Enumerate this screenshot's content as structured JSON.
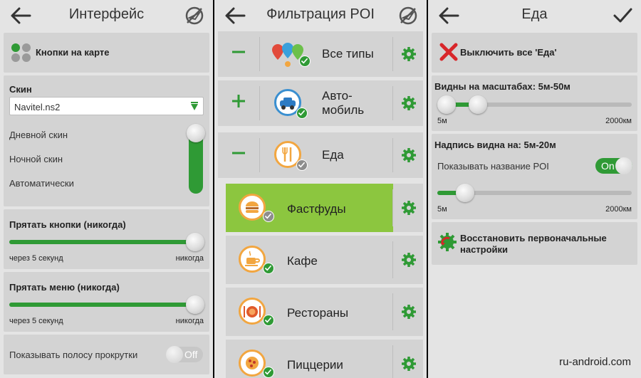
{
  "panel1": {
    "title": "Интерфейс",
    "map_buttons_label": "Кнопки на карте",
    "skin": {
      "label": "Скин",
      "selected": "Navitel.ns2",
      "options": [
        "Дневной скин",
        "Ночной скин",
        "Автоматически"
      ]
    },
    "hide_buttons": {
      "label": "Прятать кнопки (никогда)",
      "min": "через 5 секунд",
      "max": "никогда",
      "value": 1.0
    },
    "hide_menu": {
      "label": "Прятать меню (никогда)",
      "min": "через 5 секунд",
      "max": "никогда",
      "value": 1.0
    },
    "scrollbar": {
      "label": "Показывать полосу прокрутки",
      "toggle": "Off"
    }
  },
  "panel2": {
    "title": "Фильтрация POI",
    "rows": [
      {
        "sign": "−",
        "label": "Все типы",
        "sub": false,
        "active": false
      },
      {
        "sign": "+",
        "label": "Авто-\nмобиль",
        "sub": false,
        "active": false
      },
      {
        "sign": "−",
        "label": "Еда",
        "sub": false,
        "active": false
      },
      {
        "sign": "",
        "label": "Фастфуды",
        "sub": true,
        "active": true
      },
      {
        "sign": "",
        "label": "Кафе",
        "sub": true,
        "active": false
      },
      {
        "sign": "",
        "label": "Рестораны",
        "sub": true,
        "active": false
      },
      {
        "sign": "",
        "label": "Пиццерии",
        "sub": true,
        "active": false
      }
    ]
  },
  "panel3": {
    "title": "Еда",
    "disable_all": "Выключить все 'Еда'",
    "visible_scales": {
      "label": "Видны на масштабах: 5м-50м",
      "min": "5м",
      "max": "2000км",
      "range": [
        0.0,
        0.17
      ]
    },
    "label_visible": {
      "label": "Надпись видна на: 5м-20м",
      "poi_name_label": "Показывать название POI",
      "toggle": "On",
      "min": "5м",
      "max": "2000км",
      "value": 0.14
    },
    "restore": "Восстановить первоначальные настройки"
  },
  "watermark": "ru-android.com",
  "colors": {
    "green": "#2f9a35",
    "active_row": "#8cc63f",
    "panel_bg": "#e4e4e4",
    "card_bg": "#d3d3d3",
    "red_x": "#d8262a"
  }
}
